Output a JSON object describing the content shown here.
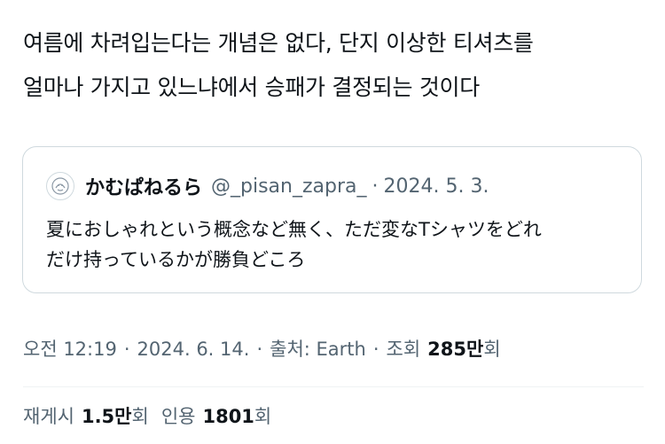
{
  "tweet": {
    "text_lines": [
      "여름에 차려입는다는 개념은 없다, 단지 이상한 티셔츠를",
      "얼마나 가지고 있느냐에서 승패가 결정되는 것이다"
    ]
  },
  "quote": {
    "name": "かむぱねるら",
    "handle": "@_pisan_zapra_",
    "separator": "·",
    "date": "2024. 5. 3.",
    "text_lines": [
      "夏におしゃれという概念など無く、ただ変なTシャツをどれ",
      "だけ持っているかが勝負どころ"
    ]
  },
  "meta": {
    "time": "오전 12:19",
    "sep": "·",
    "date": "2024. 6. 14.",
    "source_label": "출처: Earth",
    "views_prefix": "조회",
    "views_count": "285만",
    "views_suffix": "회"
  },
  "stats": {
    "reposts_label": "재게시",
    "reposts_count": "1.5만",
    "reposts_suffix": "회",
    "quotes_label": "인용",
    "quotes_count": "1801",
    "quotes_suffix": "회"
  },
  "colors": {
    "text": "#0f1419",
    "secondary": "#536471",
    "border": "#cfd9de"
  }
}
